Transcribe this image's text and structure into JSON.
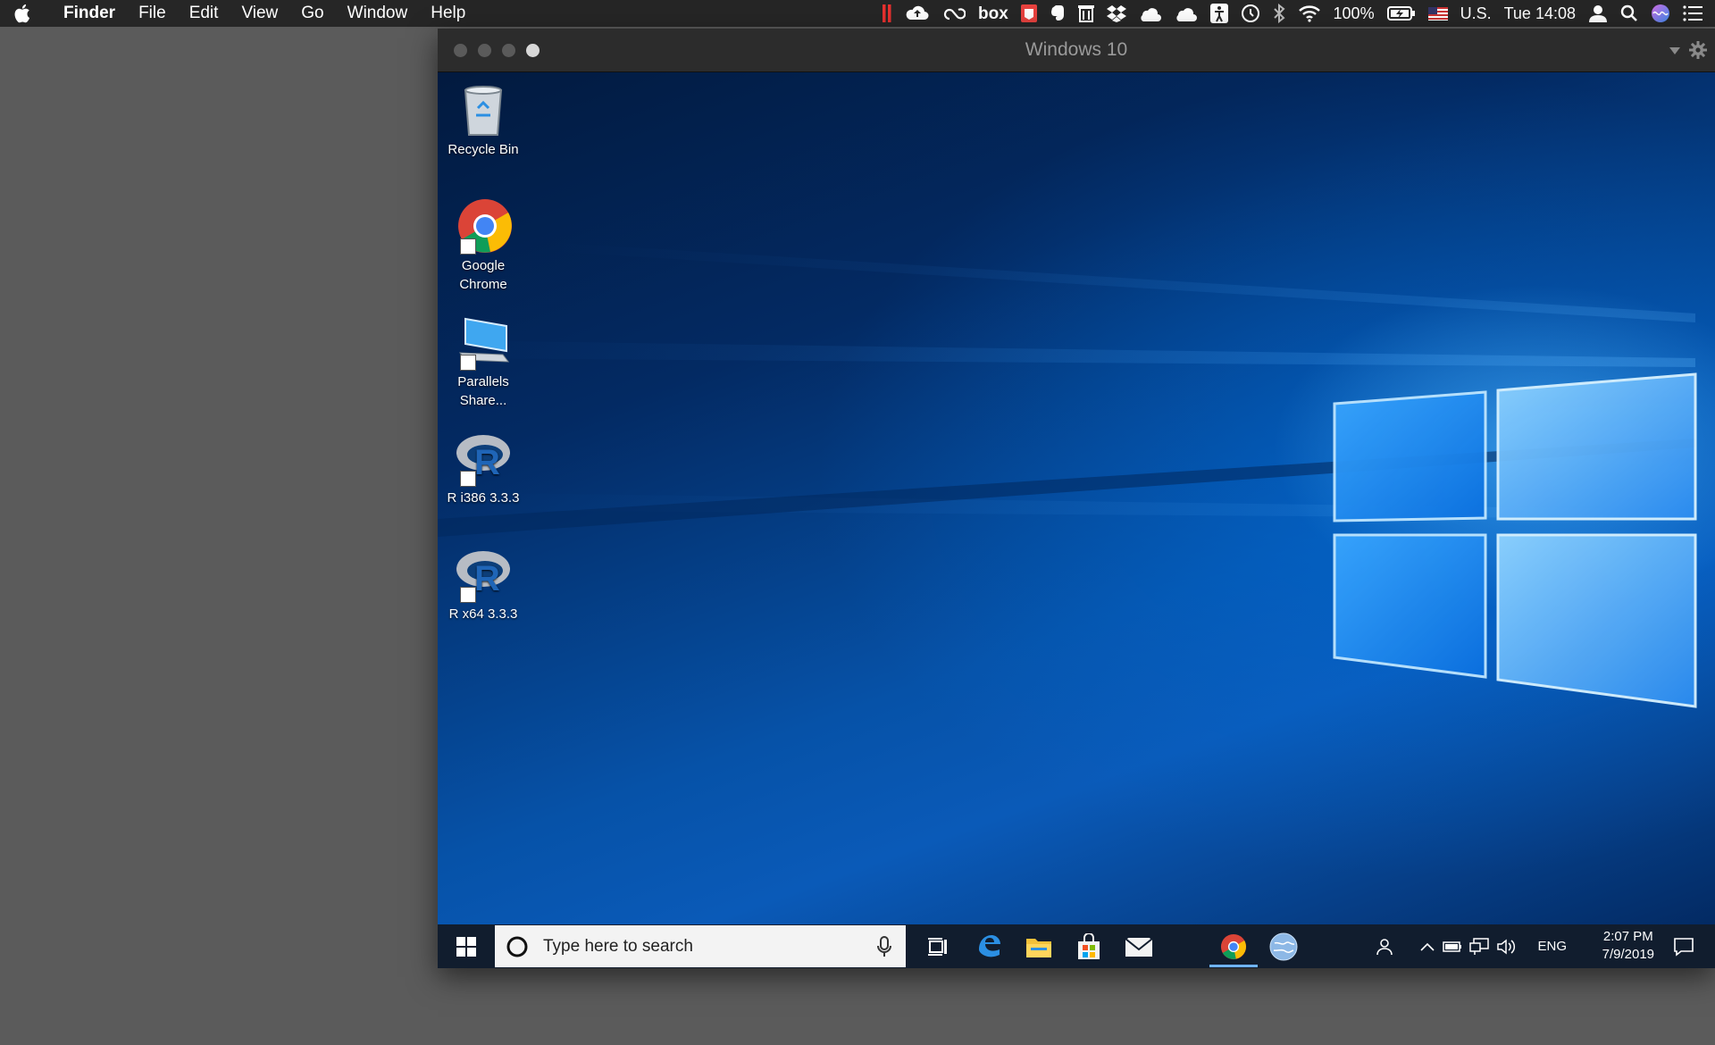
{
  "mac_menubar": {
    "app_name": "Finder",
    "menus": [
      "File",
      "Edit",
      "View",
      "Go",
      "Window",
      "Help"
    ],
    "battery": "100%",
    "input_source": "U.S.",
    "clock": "Tue 14:08"
  },
  "vm_window": {
    "title": "Windows 10"
  },
  "desktop": {
    "icons": [
      {
        "label": "Recycle Bin"
      },
      {
        "label": "Google Chrome"
      },
      {
        "label": "Parallels Share..."
      },
      {
        "label": "R i386 3.3.3"
      },
      {
        "label": "R x64 3.3.3"
      }
    ]
  },
  "taskbar": {
    "search_placeholder": "Type here to search",
    "language": "ENG",
    "time": "2:07 PM",
    "date": "7/9/2019",
    "pinned": [
      "task-view",
      "edge",
      "file-explorer",
      "store",
      "mail",
      "chrome",
      "parallels"
    ]
  },
  "colors": {
    "mac_menubar_bg": "#262626",
    "taskbar_bg": "#111d2e",
    "desktop_blue": "#0652a8",
    "chrome_active_underline": "#6fb3ff"
  }
}
